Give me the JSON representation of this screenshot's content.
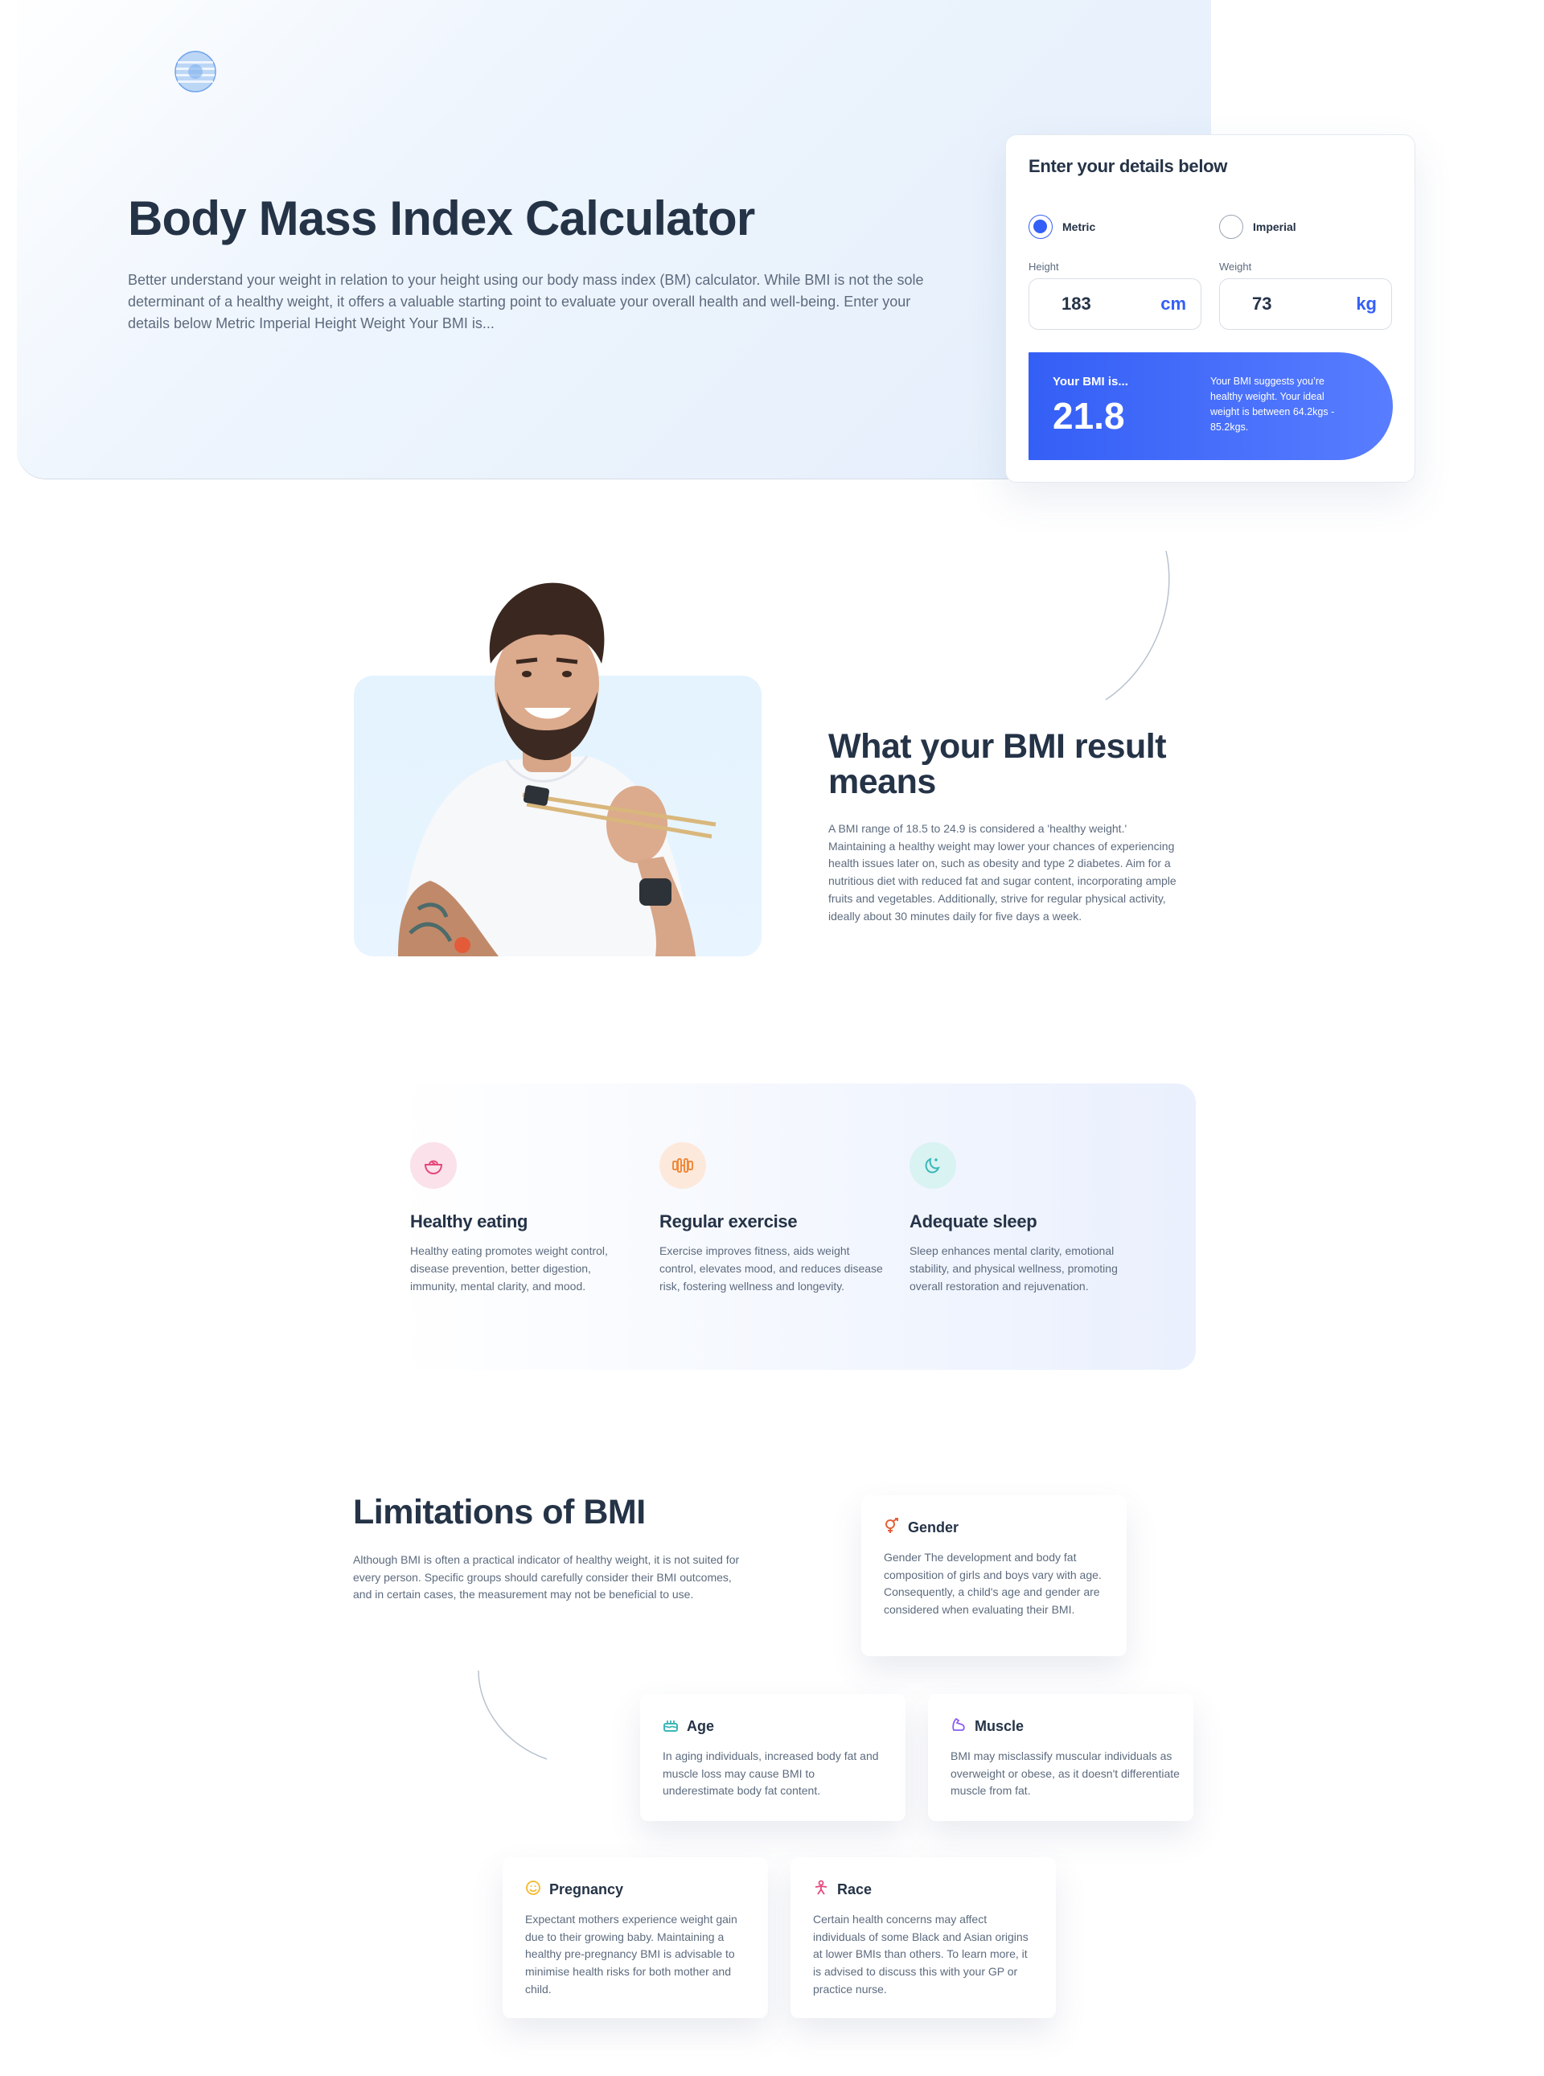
{
  "hero": {
    "title": "Body Mass Index Calculator",
    "description": "Better understand your weight in relation to your height using our body mass index (BM) calculator. While BMI is not the sole determinant of a healthy weight, it offers a valuable starting point to evaluate your overall health and well-being. Enter your details below Metric Imperial Height Weight Your BMI is..."
  },
  "form": {
    "title": "Enter your details below",
    "unit_options": [
      {
        "label": "Metric",
        "selected": true
      },
      {
        "label": "Imperial",
        "selected": false
      }
    ],
    "height": {
      "label": "Height",
      "value": "183",
      "unit": "cm"
    },
    "weight": {
      "label": "Weight",
      "value": "73",
      "unit": "kg"
    },
    "result": {
      "label": "Your BMI is...",
      "value": "21.8",
      "message": "Your BMI suggests you’re healthy weight. Your ideal weight is between 64.2kgs - 85.2kgs."
    }
  },
  "meaning": {
    "title": "What your BMI result means",
    "text": "A BMI range of 18.5 to 24.9 is considered a 'healthy weight.' Maintaining a healthy weight may lower your chances of experiencing health issues later on, such as obesity and type 2 diabetes. Aim for a nutritious diet with reduced fat and sugar content, incorporating ample fruits and vegetables. Additionally, strive for regular physical activity, ideally about 30 minutes daily for five days a week."
  },
  "tips": [
    {
      "icon": "food-bowl-icon",
      "title": "Healthy eating",
      "text": "Healthy eating promotes weight control, disease prevention, better digestion, immunity, mental clarity, and mood.",
      "color": "#e5497a",
      "bg": "#fbe1ea"
    },
    {
      "icon": "dumbbell-icon",
      "title": "Regular exercise",
      "text": "Exercise improves fitness, aids weight control, elevates mood, and reduces disease risk, fostering wellness and longevity.",
      "color": "#f08a3c",
      "bg": "#fde9dc"
    },
    {
      "icon": "moon-icon",
      "title": "Adequate sleep",
      "text": "Sleep enhances mental clarity, emotional stability, and physical wellness, promoting overall restoration and rejuvenation.",
      "color": "#3bb6b8",
      "bg": "#d8f3f2"
    }
  ],
  "limitations": {
    "title": "Limitations of BMI",
    "text": "Although BMI is often a practical indicator of healthy weight, it is not suited for every person. Specific groups should carefully consider their BMI outcomes, and in certain cases, the measurement may not be beneficial to use.",
    "items": [
      {
        "icon": "gender-icon",
        "title": "Gender",
        "text": "Gender The development and body fat composition of girls and boys vary with age. Consequently, a child's age and gender are considered when evaluating their BMI.",
        "color": "#e5603b"
      },
      {
        "icon": "cake-icon",
        "title": "Age",
        "text": "In aging individuals, increased body fat and muscle loss may cause BMI to underestimate body fat content.",
        "color": "#3bb6b8"
      },
      {
        "icon": "muscle-icon",
        "title": "Muscle",
        "text": "BMI may misclassify muscular individuals as overweight or obese, as it doesn't differentiate muscle from fat.",
        "color": "#8b5cf6"
      },
      {
        "icon": "smiley-icon",
        "title": "Pregnancy",
        "text": "Expectant mothers experience weight gain due to their growing baby. Maintaining a healthy pre-pregnancy BMI is advisable to minimise health risks for both mother and child.",
        "color": "#f5b92f"
      },
      {
        "icon": "person-icon",
        "title": "Race",
        "text": "Certain health concerns may affect individuals of some Black and Asian origins at lower BMIs than others. To learn more, it is advised to discuss this with your GP or practice nurse.",
        "color": "#e5497a"
      }
    ]
  }
}
